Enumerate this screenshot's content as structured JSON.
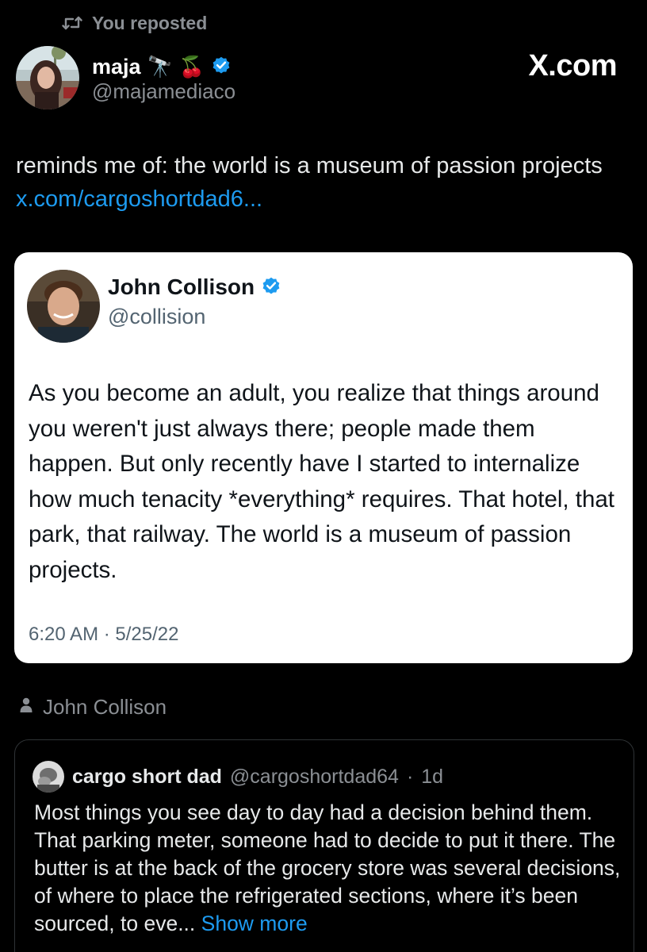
{
  "repost": {
    "label": "You reposted"
  },
  "author": {
    "name": "maja",
    "emoji_1": "🔭",
    "emoji_2": "🍒",
    "handle": "@majamediaco",
    "verified_color": "#1d9bf0"
  },
  "site_badge": "X.com",
  "post": {
    "text": "reminds me of: the world is a museum of passion projects ",
    "link": "x.com/cargoshortdad6..."
  },
  "quote": {
    "name": "John Collison",
    "handle": "@collision",
    "body": "As you become an adult, you realize that things around you weren't just always there; people made them happen. But only recently have I started to internalize how much tenacity *everything* requires. That hotel, that park, that railway. The world is a museum of passion projects.",
    "timestamp": "6:20 AM · 5/25/22"
  },
  "context": {
    "icon": "person-icon",
    "label": "John Collison"
  },
  "nested": {
    "name": "cargo short dad",
    "handle": "@cargoshortdad64",
    "separator": "·",
    "age": "1d",
    "body": "Most things you see day to day had a decision behind them. That parking meter, someone had to decide to put it there. The butter is at the back of the grocery store was several decisions, of where to place the refrigerated sections, where it’s been sourced, to eve... ",
    "show_more": "Show more"
  },
  "colors": {
    "background": "#000000",
    "text": "#e7e9ea",
    "muted": "#8b8f94",
    "link": "#1d9bf0",
    "card": "#ffffff"
  }
}
